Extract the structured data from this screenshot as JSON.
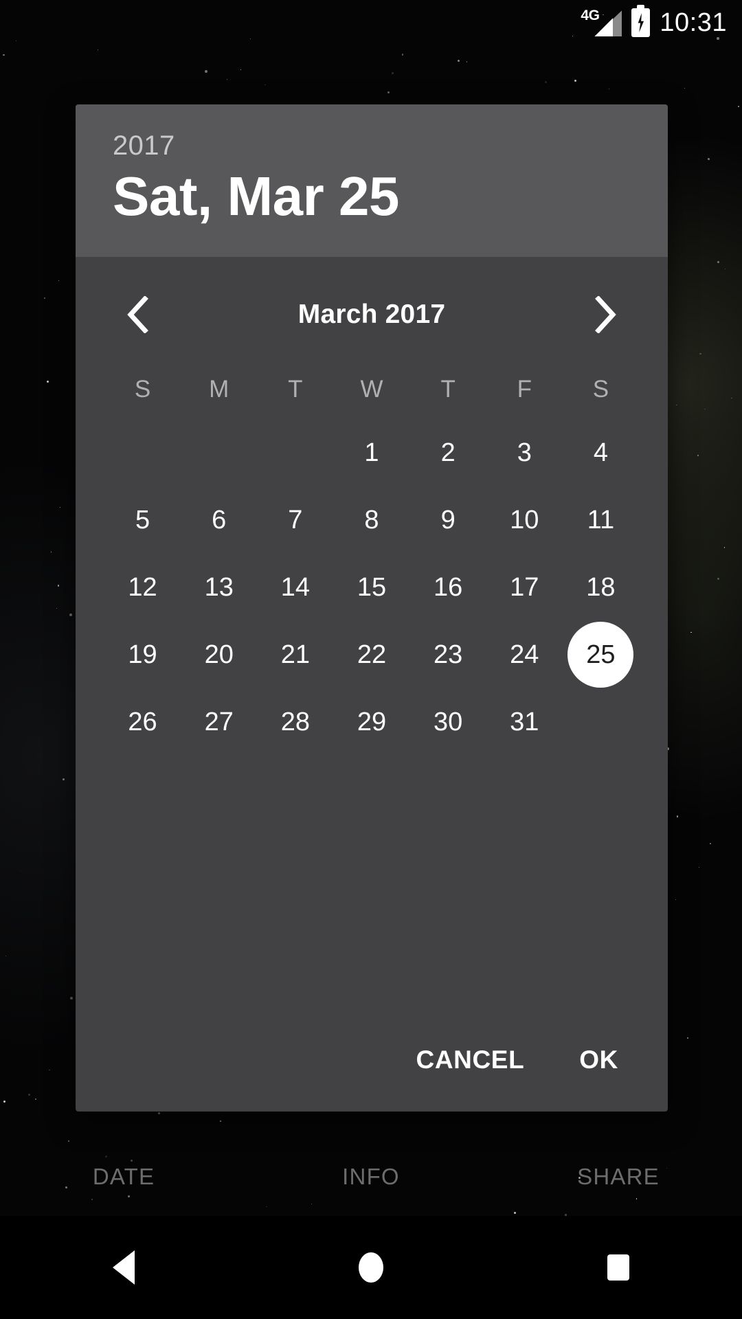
{
  "status_bar": {
    "network_label": "4G",
    "time": "10:31",
    "signal_icon": "signal-bars-icon",
    "battery_icon": "battery-charging-icon"
  },
  "dialog": {
    "header": {
      "year": "2017",
      "date": "Sat, Mar 25"
    },
    "month_nav": {
      "prev_icon": "chevron-left-icon",
      "next_icon": "chevron-right-icon",
      "label": "March 2017"
    },
    "weekdays": [
      "S",
      "M",
      "T",
      "W",
      "T",
      "F",
      "S"
    ],
    "weeks": [
      [
        "",
        "",
        "",
        "1",
        "2",
        "3",
        "4"
      ],
      [
        "5",
        "6",
        "7",
        "8",
        "9",
        "10",
        "11"
      ],
      [
        "12",
        "13",
        "14",
        "15",
        "16",
        "17",
        "18"
      ],
      [
        "19",
        "20",
        "21",
        "22",
        "23",
        "24",
        "25"
      ],
      [
        "26",
        "27",
        "28",
        "29",
        "30",
        "31",
        ""
      ]
    ],
    "selected_day": "25",
    "actions": {
      "cancel": "CANCEL",
      "ok": "OK"
    },
    "colors": {
      "header_bg": "#58585a",
      "body_bg": "#424244",
      "selection_bg": "#ffffff",
      "selection_text": "#1f1f1f",
      "muted_text": "#b0b0b0"
    }
  },
  "background_tabs": [
    {
      "label": "DATE"
    },
    {
      "label": "INFO"
    },
    {
      "label": "SHARE"
    }
  ],
  "nav_bar": {
    "back_icon": "back-triangle-icon",
    "home_icon": "home-circle-icon",
    "recents_icon": "recents-square-icon"
  }
}
